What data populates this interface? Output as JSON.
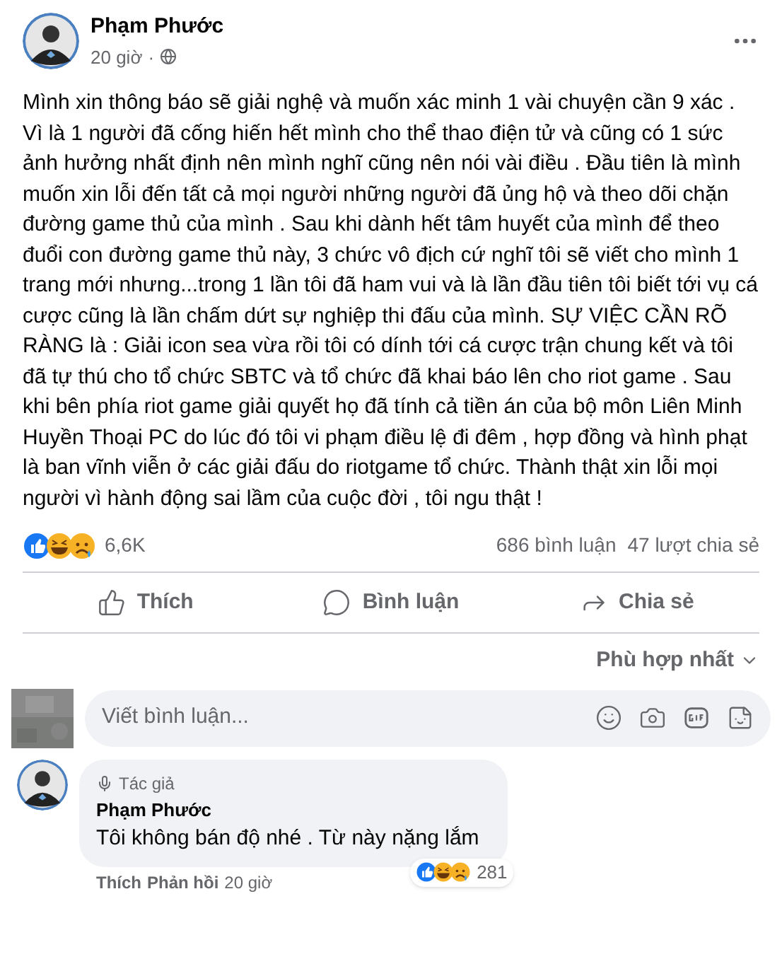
{
  "post": {
    "author": "Phạm Phước",
    "time": "20 giờ",
    "separator": "·",
    "body": "Mình xin thông báo sẽ giải nghệ và muốn xác minh 1 vài chuyện cần 9 xác . Vì là 1 người đã cống hiến hết mình cho thể thao điện tử và cũng có 1 sức ảnh hưởng nhất định nên mình nghĩ cũng nên nói vài điều . Đầu tiên là mình muốn xin lỗi đến tất cả mọi người những người đã ủng hộ và theo dõi chặn đường game thủ của mình . Sau khi dành hết tâm huyết của mình để theo đuổi con đường game thủ này, 3 chức vô địch cứ nghĩ tôi sẽ viết cho mình 1 trang mới nhưng...trong 1 lần tôi đã ham vui và là lần đầu tiên tôi biết tới vụ cá cược cũng là lần chấm dứt sự nghiệp thi đấu của mình. SỰ VIỆC CẦN RÕ RÀNG là : Giải icon sea vừa rồi tôi có dính tới cá cược trận chung kết và tôi đã tự thú cho tổ chức SBTC và tổ chức đã khai báo lên cho riot game . Sau khi bên phía riot game giải quyết họ đã tính cả tiền án của bộ môn Liên Minh Huyền Thoại PC do lúc đó tôi vi phạm điều lệ đi đêm , hợp đồng và hình phạt là ban vĩnh viễn ở các giải đấu do riotgame tổ chức. Thành thật xin lỗi mọi người vì hành động sai lầm của cuộc đời , tôi ngu thật !"
  },
  "stats": {
    "reactions": "6,6K",
    "comments": "686 bình luận",
    "shares": "47 lượt chia sẻ"
  },
  "actions": [
    {
      "kind": "like",
      "label": "Thích"
    },
    {
      "kind": "comment",
      "label": "Bình luận"
    },
    {
      "kind": "share",
      "label": "Chia sẻ"
    }
  ],
  "sort": "Phù hợp nhất",
  "composer": {
    "placeholder": "Viết bình luận..."
  },
  "comments": [
    {
      "badge": "Tác giả",
      "author": "Phạm Phước",
      "text": "Tôi không bán độ nhé . Từ này nặng lắm",
      "reactions": "281",
      "links": [
        "Thích",
        "Phản hồi",
        "20 giờ"
      ]
    }
  ]
}
